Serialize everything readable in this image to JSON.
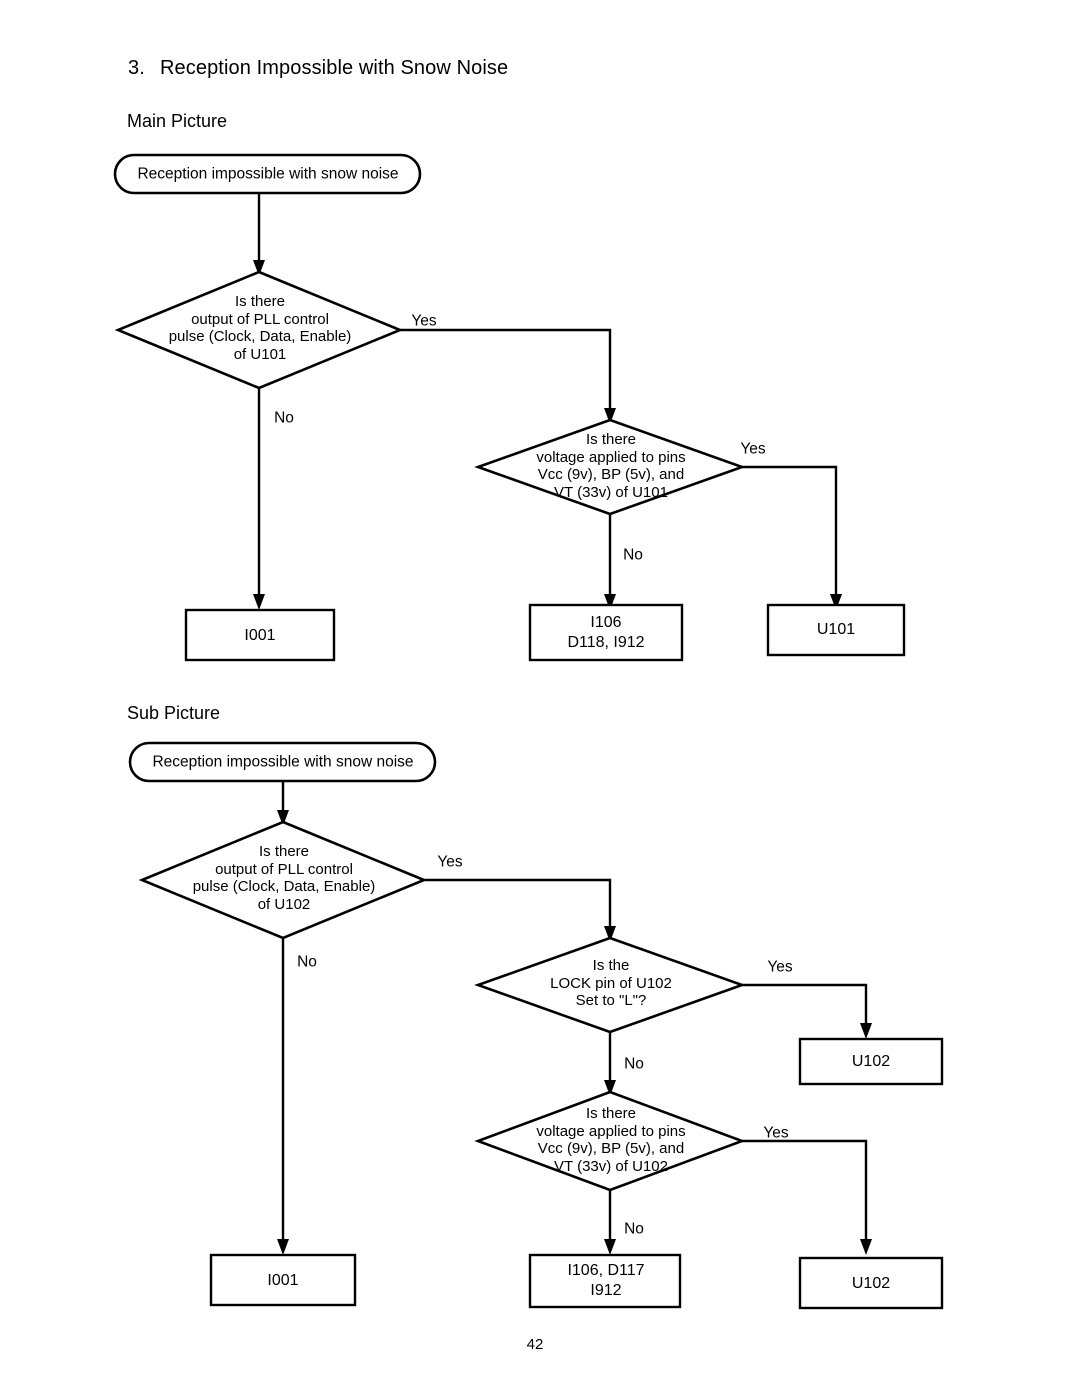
{
  "page": {
    "section_number": "3.",
    "section_title": "Reception Impossible with Snow Noise",
    "page_number": "42"
  },
  "main_picture": {
    "heading": "Main Picture",
    "start": "Reception impossible with snow noise",
    "decision_pll": "Is there\noutput of PLL control\npulse (Clock, Data, Enable)\nof U101",
    "decision_voltage": "Is there\nvoltage applied to pins\nVcc (9v), BP (5v), and\nVT (33v) of U101",
    "result_i001": "I001",
    "result_i106": "I106\nD118, I912",
    "result_u101": "U101",
    "label_pll_yes": "Yes",
    "label_pll_no": "No",
    "label_voltage_yes": "Yes",
    "label_voltage_no": "No"
  },
  "sub_picture": {
    "heading": "Sub Picture",
    "start": "Reception impossible with snow noise",
    "decision_pll": "Is there\noutput of PLL control\npulse (Clock, Data, Enable)\nof U102",
    "decision_lock": "Is the\nLOCK pin of U102\nSet to \"L\"?",
    "decision_voltage": "Is there\nvoltage applied to pins\nVcc (9v), BP (5v), and\nVT (33v) of U102",
    "result_i001": "I001",
    "result_u102_lock": "U102",
    "result_i106": "I106, D117\nI912",
    "result_u102_voltage": "U102",
    "label_pll_yes": "Yes",
    "label_pll_no": "No",
    "label_lock_yes": "Yes",
    "label_lock_no": "No",
    "label_voltage_yes": "Yes",
    "label_voltage_no": "No"
  },
  "colors": {
    "ink": "#000000",
    "paper": "#ffffff"
  }
}
